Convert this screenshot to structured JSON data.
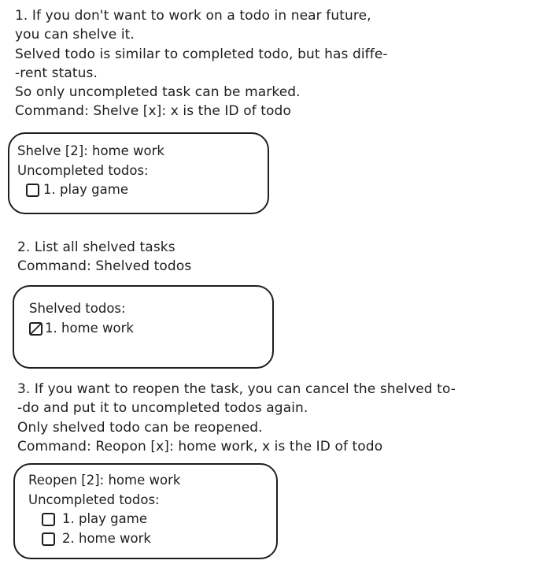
{
  "section1": {
    "lines": [
      "1. If you don't want to work on a todo in near future,",
      "you can shelve it.",
      "Selved todo is similar to completed todo, but has diffe-",
      "-rent status.",
      "So only uncompleted task can be marked.",
      "Command: Shelve [x]: x is the ID of todo"
    ],
    "example": {
      "line1": "Shelve [2]: home work",
      "line2": "Uncompleted todos:",
      "items": [
        {
          "label": "1. play game",
          "state": "unchecked"
        }
      ]
    }
  },
  "section2": {
    "lines": [
      "2. List all shelved tasks",
      "Command: Shelved todos"
    ],
    "example": {
      "line1": "Shelved todos:",
      "items": [
        {
          "label": "1. home work",
          "state": "shelved"
        }
      ]
    }
  },
  "section3": {
    "lines": [
      "3. If you want to reopen the task, you can cancel the shelved to-",
      "-do and put it to uncompleted todos again.",
      "Only shelved todo can be reopened.",
      "Command: Reopon [x]: home work, x is the ID of todo"
    ],
    "example": {
      "line1": "Reopen [2]: home work",
      "line2": "Uncompleted todos:",
      "items": [
        {
          "label": "1. play game",
          "state": "unchecked"
        },
        {
          "label": "2. home work",
          "state": "unchecked"
        }
      ]
    }
  }
}
